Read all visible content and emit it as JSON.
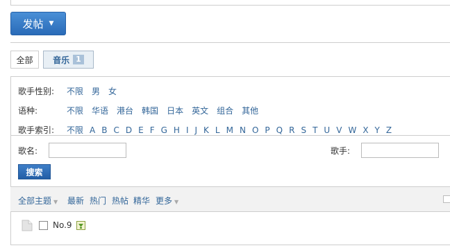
{
  "post_button": {
    "label": "发帖"
  },
  "tabs": [
    {
      "label": "全部"
    },
    {
      "label": "音乐",
      "badge": "1"
    }
  ],
  "filters": {
    "gender": {
      "label": "歌手性别:",
      "options": [
        "不限",
        "男",
        "女"
      ]
    },
    "language": {
      "label": "语种:",
      "options": [
        "不限",
        "华语",
        "港台",
        "韩国",
        "日本",
        "英文",
        "组合",
        "其他"
      ]
    },
    "index": {
      "label": "歌手索引:",
      "options": [
        "不限",
        "A",
        "B",
        "C",
        "D",
        "E",
        "F",
        "G",
        "H",
        "I",
        "J",
        "K",
        "L",
        "M",
        "N",
        "O",
        "P",
        "Q",
        "R",
        "S",
        "T",
        "U",
        "V",
        "W",
        "X",
        "Y",
        "Z"
      ]
    }
  },
  "search": {
    "song_label": "歌名:",
    "singer_label": "歌手:",
    "button_label": "搜索"
  },
  "thread_filters": {
    "all_topics": "全部主题",
    "newest": "最新",
    "hot": "热门",
    "hot_posts": "热帖",
    "digest": "精华",
    "more": "更多"
  },
  "threads": [
    {
      "title": "No.9"
    }
  ],
  "colors": {
    "link": "#336699",
    "button": "#2a6bb8"
  }
}
